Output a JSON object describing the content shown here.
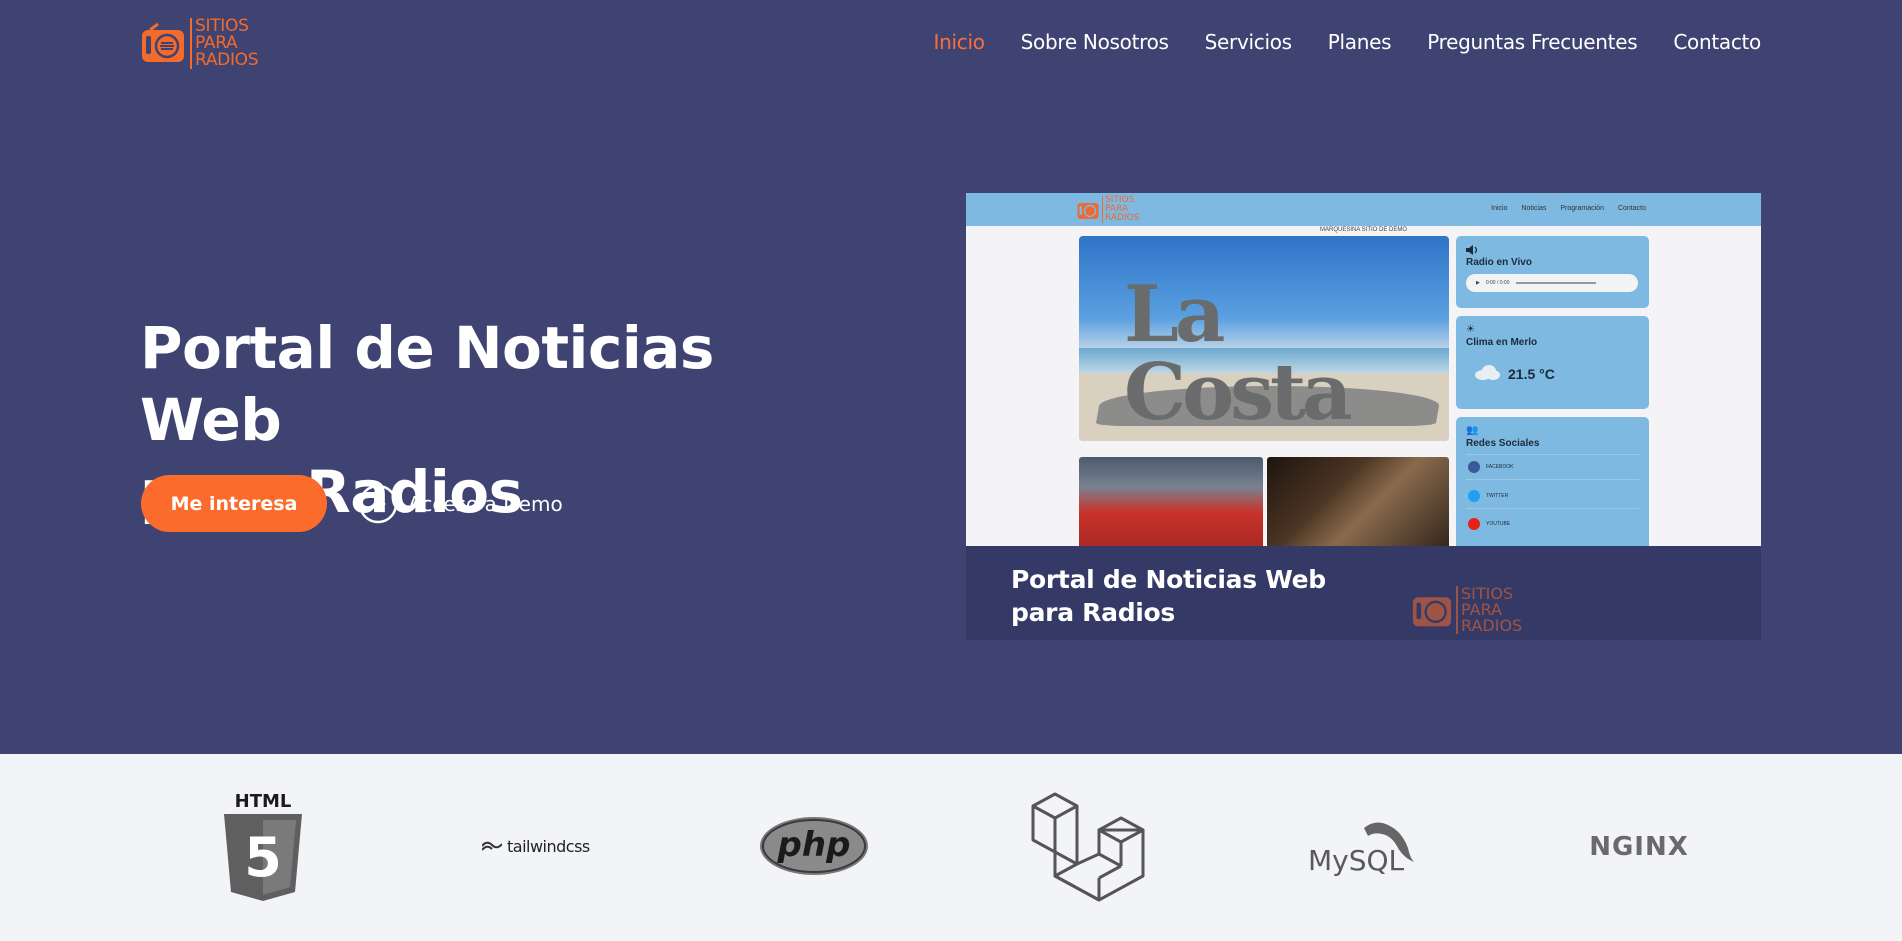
{
  "header": {
    "logo_lines": [
      "SITIOS",
      "PARA",
      "RADIOS"
    ],
    "nav": [
      {
        "label": "Inicio",
        "active": true
      },
      {
        "label": "Sobre Nosotros",
        "active": false
      },
      {
        "label": "Servicios",
        "active": false
      },
      {
        "label": "Planes",
        "active": false
      },
      {
        "label": "Preguntas Frecuentes",
        "active": false
      },
      {
        "label": "Contacto",
        "active": false
      }
    ]
  },
  "hero": {
    "title_line1": "Portal de Noticias Web",
    "title_line2": "para Radios",
    "primary_button": "Me interesa",
    "demo_link": "Acceso a Demo"
  },
  "preview": {
    "logo_lines": [
      "SITIOS",
      "PARA",
      "RADIOS"
    ],
    "nav": [
      "Inicio",
      "Noticias",
      "Programación",
      "Contacto"
    ],
    "marquee": "MARQUESINA SITIO DE DEMO",
    "sculpture_text": "La Costa",
    "radio_card_title": "Radio en Vivo",
    "audio_time": "0:00 / 0:00",
    "weather_card_title": "Clima en Merlo",
    "weather_temp": "21.5 °C",
    "social_card_title": "Redes Sociales",
    "social_links": [
      "FACEBOOK",
      "TWITTER",
      "YOUTUBE"
    ],
    "banner_line1": "Portal de Noticias Web",
    "banner_line2": "para Radios",
    "banner_logo_lines": [
      "SITIOS",
      "PARA",
      "RADIOS"
    ]
  },
  "tech": {
    "html5_label": "HTML",
    "html5_number": "5",
    "tailwind_label": "tailwindcss",
    "php_label": "php",
    "mysql_label": "MySQL",
    "nginx_label": "NGINX"
  },
  "colors": {
    "background": "#3f4372",
    "accent": "#fb6c2c",
    "tech_strip": "#f3f4f8",
    "preview_bar": "#7db9e0",
    "banner": "#353966"
  }
}
